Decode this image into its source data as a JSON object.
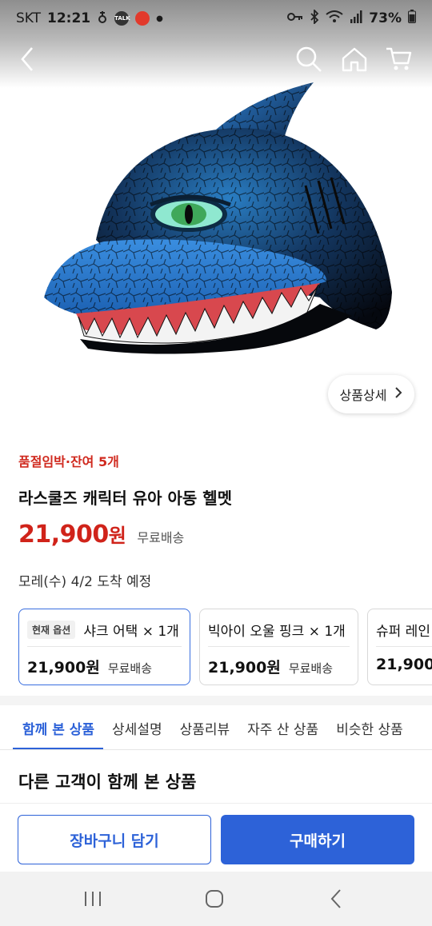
{
  "status_bar": {
    "carrier": "SKT",
    "time": "12:21",
    "battery": "73%",
    "icons": [
      "notification-icon",
      "kakaotalk-icon",
      "app-badge-icon",
      "key-icon",
      "bluetooth-icon",
      "wifi-icon",
      "signal-icon",
      "battery-icon"
    ],
    "talk_label": "TALK"
  },
  "header": {
    "icons": [
      "back-icon",
      "search-icon",
      "home-icon",
      "cart-icon"
    ]
  },
  "product": {
    "detail_button_label": "상품상세",
    "urgency": "품절임박·잔여 5개",
    "title": "라스쿨즈 캐릭터 유아 아동 헬멧",
    "price_number": "21,900",
    "price_unit": "원",
    "shipping": "무료배송",
    "arrival": "모레(수) 4/2 도착 예정"
  },
  "options": [
    {
      "tag": "현재 옵션",
      "name": "샤크 어택 × 1개",
      "price": "21,900원",
      "shipping": "무료배송",
      "selected": true
    },
    {
      "tag": "",
      "name": "빅아이 오울 핑크 × 1개",
      "price": "21,900원",
      "shipping": "무료배송",
      "selected": false
    },
    {
      "tag": "",
      "name": "슈퍼 레인",
      "price": "21,900",
      "shipping": "",
      "selected": false
    }
  ],
  "tabs": [
    {
      "label": "함께 본 상품",
      "active": true
    },
    {
      "label": "상세설명",
      "active": false
    },
    {
      "label": "상품리뷰",
      "active": false
    },
    {
      "label": "자주 산 상품",
      "active": false
    },
    {
      "label": "비슷한 상품",
      "active": false
    }
  ],
  "section_title": "다른 고객이 함께 본 상품",
  "actions": {
    "cart_label": "장바구니 담기",
    "buy_label": "구매하기"
  },
  "colors": {
    "accent": "#2d62d8",
    "price": "#d0231a",
    "urgent": "#d02a1f"
  },
  "nav_bar": {
    "icons": [
      "recent-apps-icon",
      "home-nav-icon",
      "back-nav-icon"
    ]
  }
}
